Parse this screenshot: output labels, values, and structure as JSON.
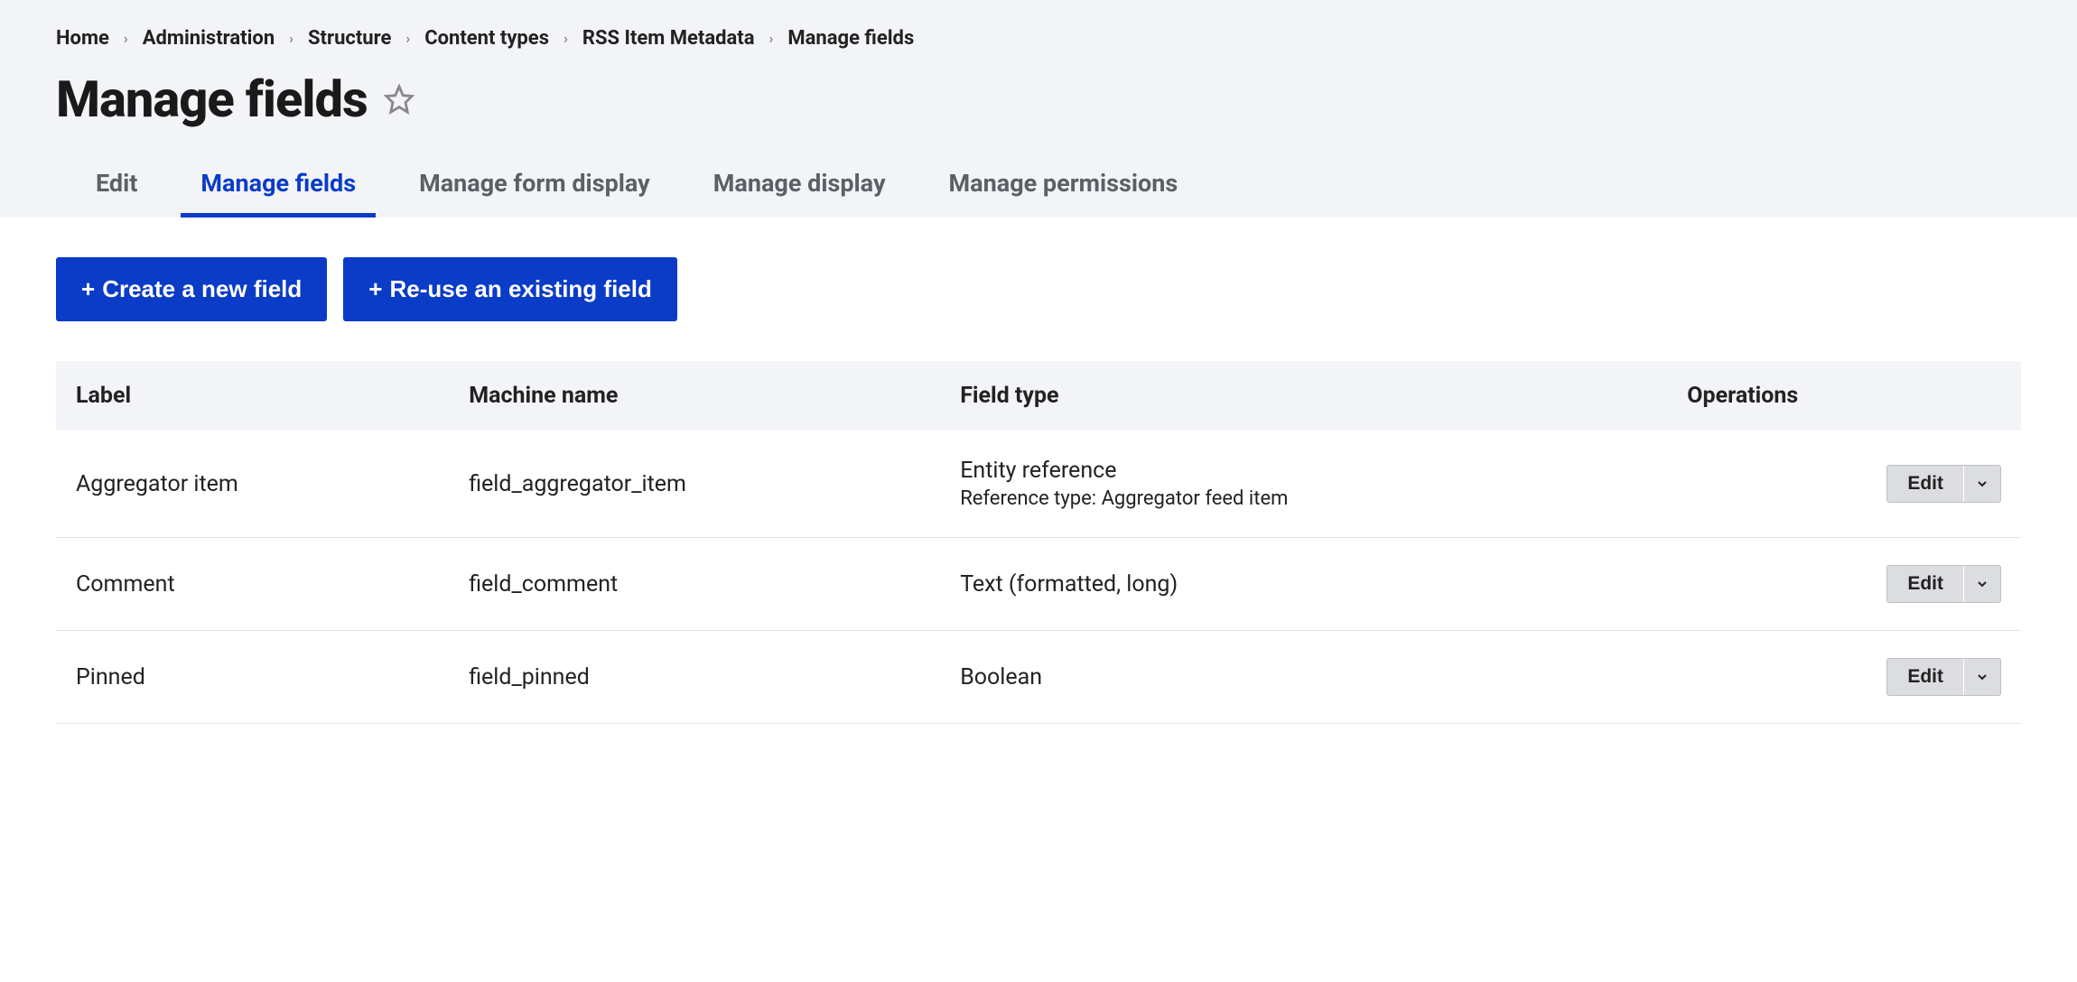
{
  "breadcrumb": {
    "items": [
      {
        "label": "Home"
      },
      {
        "label": "Administration"
      },
      {
        "label": "Structure"
      },
      {
        "label": "Content types"
      },
      {
        "label": "RSS Item Metadata"
      }
    ],
    "current": "Manage fields"
  },
  "page_title": "Manage fields",
  "tabs": [
    {
      "label": "Edit",
      "active": false
    },
    {
      "label": "Manage fields",
      "active": true
    },
    {
      "label": "Manage form display",
      "active": false
    },
    {
      "label": "Manage display",
      "active": false
    },
    {
      "label": "Manage permissions",
      "active": false
    }
  ],
  "actions": {
    "create_new": "Create a new field",
    "reuse": "Re-use an existing field"
  },
  "table": {
    "headers": {
      "label": "Label",
      "machine_name": "Machine name",
      "field_type": "Field type",
      "operations": "Operations"
    },
    "rows": [
      {
        "label": "Aggregator item",
        "machine_name": "field_aggregator_item",
        "field_type": "Entity reference",
        "field_subtext": "Reference type: Aggregator feed item",
        "op_label": "Edit"
      },
      {
        "label": "Comment",
        "machine_name": "field_comment",
        "field_type": "Text (formatted, long)",
        "field_subtext": "",
        "op_label": "Edit"
      },
      {
        "label": "Pinned",
        "machine_name": "field_pinned",
        "field_type": "Boolean",
        "field_subtext": "",
        "op_label": "Edit"
      }
    ]
  }
}
